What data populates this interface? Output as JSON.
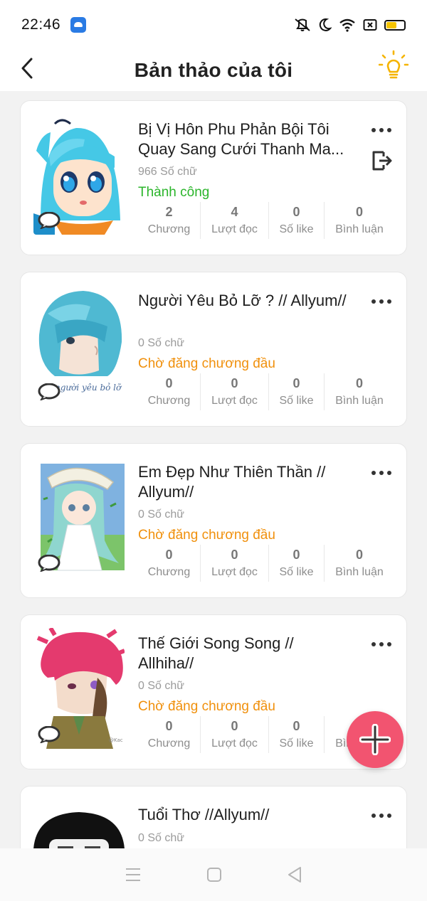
{
  "status_bar": {
    "time": "22:46"
  },
  "header": {
    "title": "Bản thảo của tôi"
  },
  "colors": {
    "success": "#2bb52b",
    "pending": "#f0900c",
    "fab": "#f25470"
  },
  "stat_labels": {
    "chapters": "Chương",
    "reads": "Lượt đọc",
    "likes": "Số like",
    "comments": "Bình luận"
  },
  "stories": [
    {
      "title": "Bị Vị Hôn Phu Phản Bội Tôi Quay Sang Cưới Thanh Ma...",
      "words": "966 Số chữ",
      "status": "Thành công",
      "status_type": "success",
      "chapters": "2",
      "reads": "4",
      "likes": "0",
      "comments": "0",
      "cover": "cover-blue-hair-anime"
    },
    {
      "title": "Người Yêu Bỏ Lỡ ? // Allyum//",
      "words": "0 Số chữ",
      "status": "Chờ đăng chương đầu",
      "status_type": "pending",
      "chapters": "0",
      "reads": "0",
      "likes": "0",
      "comments": "0",
      "cover": "cover-teal-hair-sketch",
      "cover_text": "người yêu bỏ lỡ"
    },
    {
      "title": "Em Đẹp Như Thiên Thần // Allyum//",
      "words": "0 Số chữ",
      "status": "Chờ đăng chương đầu",
      "status_type": "pending",
      "chapters": "0",
      "reads": "0",
      "likes": "0",
      "comments": "0",
      "cover": "cover-girl-white-dress"
    },
    {
      "title": "Thế Giới Song Song // Allhiha//",
      "words": "0 Số chữ",
      "status": "Chờ đăng chương đầu",
      "status_type": "pending",
      "chapters": "0",
      "reads": "0",
      "likes": "0",
      "comments": "0",
      "cover": "cover-pink-hair-boy",
      "cover_text": "@Kac"
    },
    {
      "title": "Tuổi Thơ //Allyum//",
      "words": "0 Số chữ",
      "cover": "cover-black-hair"
    }
  ]
}
